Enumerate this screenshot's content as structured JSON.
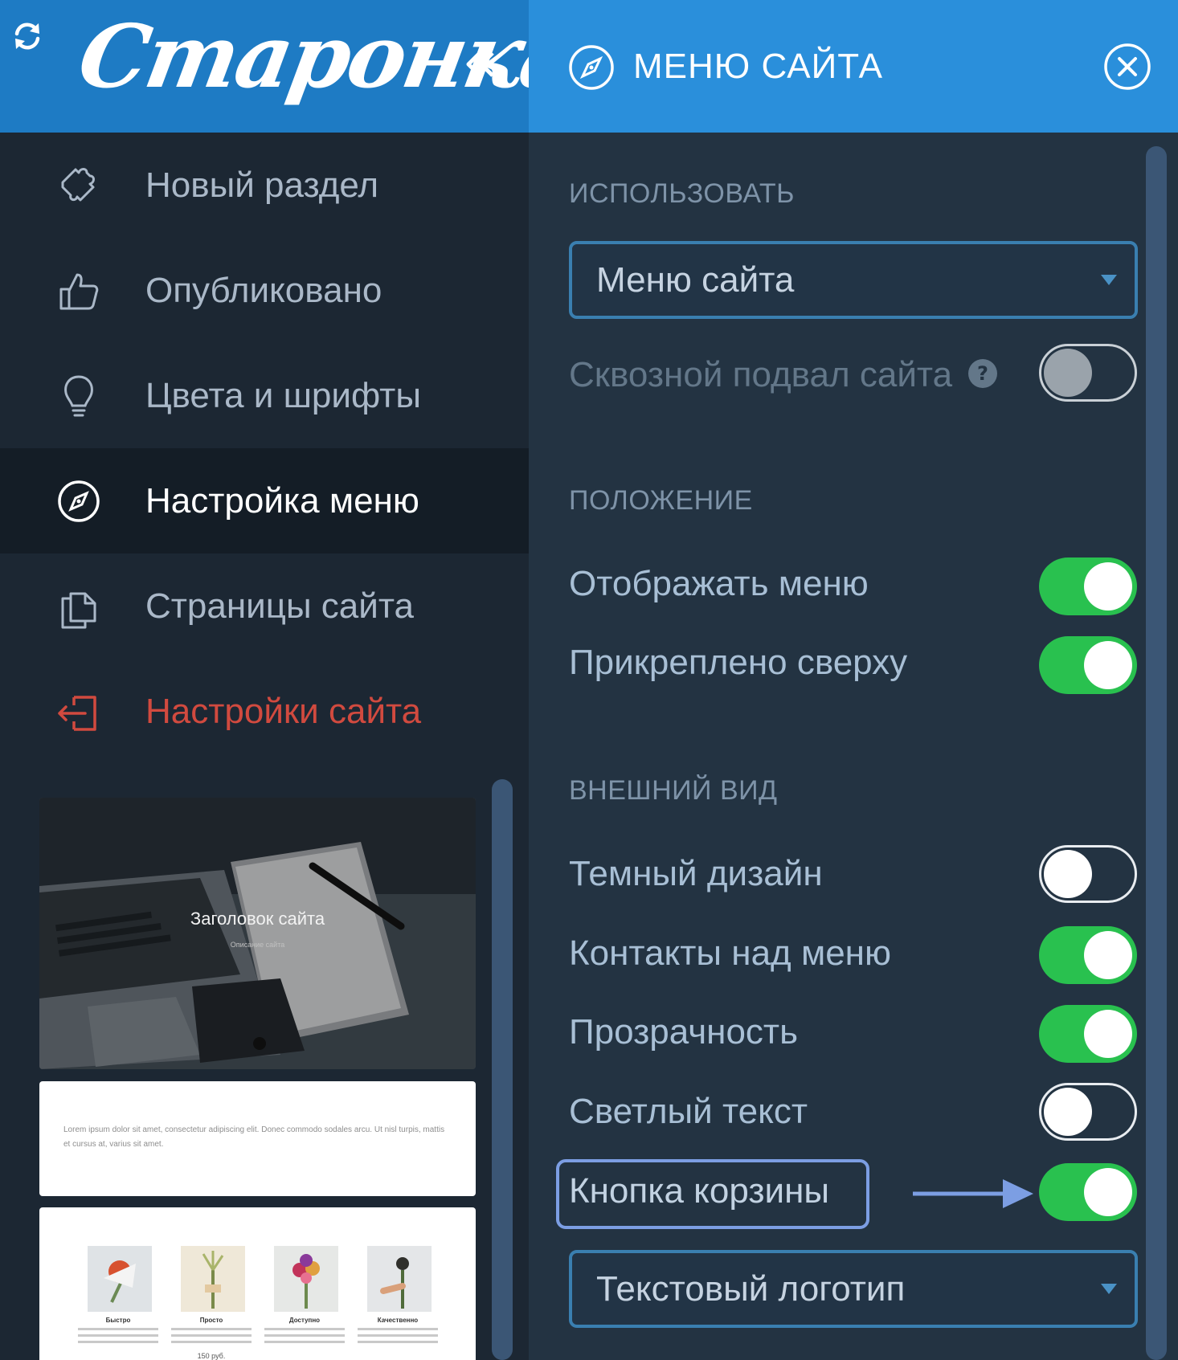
{
  "brand": {
    "logo_text": "Старонка"
  },
  "sidebar": {
    "items": [
      {
        "label": "Новый раздел",
        "icon": "puzzle-icon"
      },
      {
        "label": "Опубликовано",
        "icon": "thumbs-up-icon"
      },
      {
        "label": "Цвета и шрифты",
        "icon": "lightbulb-icon"
      },
      {
        "label": "Настройка меню",
        "icon": "compass-icon",
        "active": true
      },
      {
        "label": "Страницы сайта",
        "icon": "pages-icon"
      },
      {
        "label": "Настройки сайта",
        "icon": "exit-icon"
      }
    ]
  },
  "preview": {
    "hero_title": "Заголовок сайта",
    "hero_subtitle": "Описание сайта",
    "paragraph": "Lorem ipsum dolor sit amet, consectetur adipiscing elit. Donec commodo sodales arcu. Ut nisl turpis, mattis et cursus at, varius sit amet.",
    "products": [
      {
        "name": "Быстро",
        "price": ""
      },
      {
        "name": "Просто",
        "price": "150 руб."
      },
      {
        "name": "Доступно",
        "price": ""
      },
      {
        "name": "Качественно",
        "price": ""
      }
    ]
  },
  "panel": {
    "title": "МЕНЮ САЙТА",
    "sections": {
      "use": "ИСПОЛЬЗОВАТЬ",
      "position": "ПОЛОЖЕНИЕ",
      "appearance": "ВНЕШНИЙ ВИД"
    },
    "use_select": "Меню сайта",
    "footer_toggle": {
      "label": "Сквозной подвал сайта",
      "state": "disabled-off"
    },
    "position_toggles": [
      {
        "label": "Отображать меню",
        "on": true
      },
      {
        "label": "Прикреплено сверху",
        "on": true
      }
    ],
    "appearance_toggles": [
      {
        "label": "Темный дизайн",
        "on": false
      },
      {
        "label": "Контакты над меню",
        "on": true
      },
      {
        "label": "Прозрачность",
        "on": true
      },
      {
        "label": "Светлый текст",
        "on": false
      },
      {
        "label": "Кнопка корзины",
        "on": true,
        "highlighted": true
      }
    ],
    "logo_select": "Текстовый логотип"
  },
  "colors": {
    "header_left": "#1e7bc4",
    "header_right": "#2a8fdb",
    "toggle_on": "#29c14f",
    "danger": "#d14a3f",
    "highlight": "#7c9ee3"
  }
}
